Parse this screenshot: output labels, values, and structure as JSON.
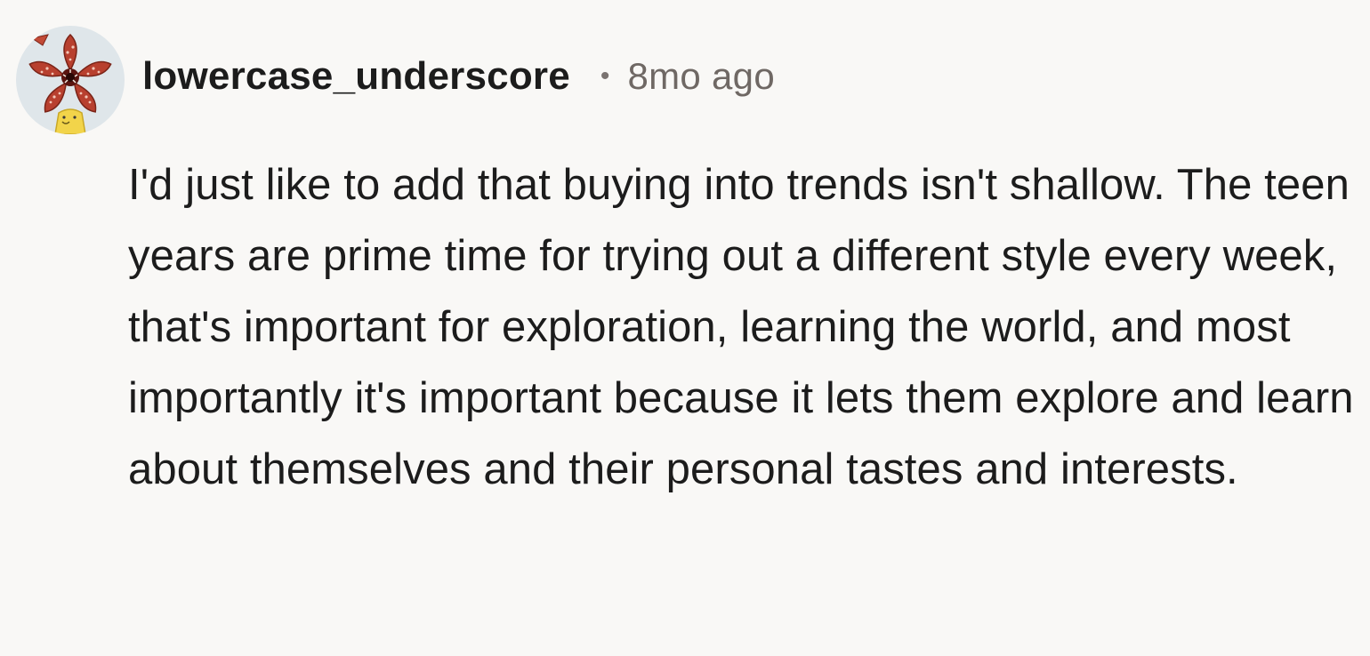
{
  "comment": {
    "author": "lowercase_underscore",
    "separator": "•",
    "timestamp": "8mo ago",
    "avatar_icon": "demogorgon-flower-avatar-icon",
    "body": "I'd just like to add that buying into trends isn't shallow. The teen years are prime time for trying out a different style every week, that's important for exploration, learning the world, and most importantly it's important because it lets them explore and learn about themselves and their personal tastes and interests."
  },
  "colors": {
    "background": "#f9f8f6",
    "text": "#1c1c1c",
    "muted": "#6f6864",
    "avatar_bg": "#dfe6ea",
    "avatar_petal": "#b8402f"
  }
}
